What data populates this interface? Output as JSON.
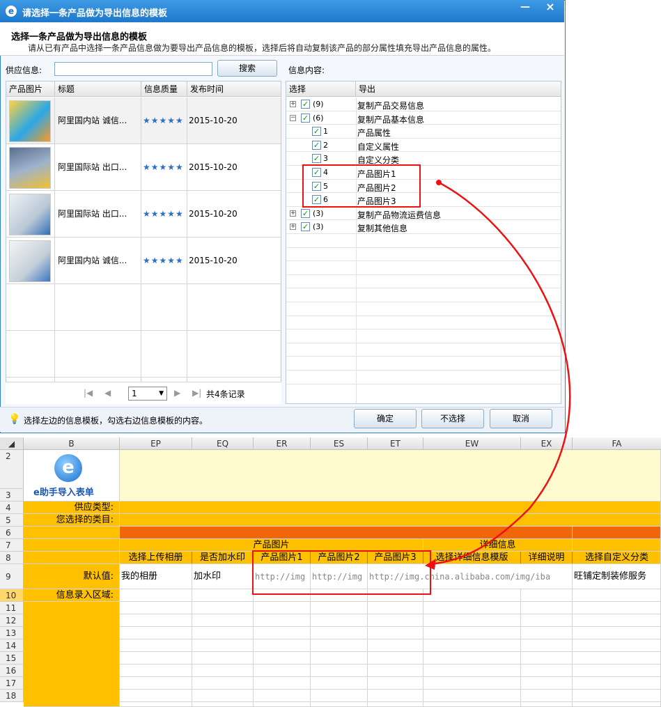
{
  "dialog": {
    "title": "请选择一条产品做为导出信息的模板",
    "min_label": "—",
    "close_label": "×",
    "heading": "选择一条产品做为导出信息的模板",
    "subheading": "请从已有产品中选择一条产品信息做为要导出产品信息的模板，选择后将自动复制该产品的部分属性填充导出产品信息的属性。",
    "supply_label": "供应信息:",
    "search_placeholder": "",
    "search_button": "搜索",
    "info_label": "信息内容:"
  },
  "left_table": {
    "columns": [
      "产品图片",
      "标题",
      "信息质量",
      "发布时间"
    ],
    "rows": [
      {
        "title": "阿里国内站 诚信...",
        "stars": "★★★★★",
        "date": "2015-10-20"
      },
      {
        "title": "阿里国际站 出口...",
        "stars": "★★★★★",
        "date": "2015-10-20"
      },
      {
        "title": "阿里国际站 出口...",
        "stars": "★★★★★",
        "date": "2015-10-20"
      },
      {
        "title": "阿里国内站 诚信...",
        "stars": "★★★★★",
        "date": "2015-10-20"
      }
    ],
    "pager": {
      "first": "|◀",
      "prev": "◀",
      "page": "1",
      "next": "▶",
      "last": "▶|",
      "total": "共4条记录"
    }
  },
  "tree": {
    "columns": [
      "选择",
      "导出"
    ],
    "rows": [
      {
        "pm": "+",
        "num": "(9)",
        "label": "复制产品交易信息"
      },
      {
        "pm": "−",
        "num": "(6)",
        "label": "复制产品基本信息"
      },
      {
        "pm": "",
        "num": "1",
        "label": "产品属性"
      },
      {
        "pm": "",
        "num": "2",
        "label": "自定义属性"
      },
      {
        "pm": "",
        "num": "3",
        "label": "自定义分类"
      },
      {
        "pm": "",
        "num": "4",
        "label": "产品图片1"
      },
      {
        "pm": "",
        "num": "5",
        "label": "产品图片2"
      },
      {
        "pm": "",
        "num": "6",
        "label": "产品图片3"
      },
      {
        "pm": "+",
        "num": "(3)",
        "label": "复制产品物流运费信息"
      },
      {
        "pm": "+",
        "num": "(3)",
        "label": "复制其他信息"
      }
    ]
  },
  "status": {
    "tip": "选择左边的信息模板，勾选右边信息模板的内容。",
    "ok": "确定",
    "none": "不选择",
    "cancel": "取消"
  },
  "sheet": {
    "columns": [
      "B",
      "EP",
      "EQ",
      "ER",
      "ES",
      "ET",
      "EW",
      "EX",
      "FA"
    ],
    "row_nums": [
      "2",
      "3",
      "4",
      "5",
      "6",
      "7",
      "8",
      "9",
      "10",
      "11",
      "12",
      "13",
      "14",
      "15",
      "16",
      "17",
      "18"
    ],
    "logo_text": "e助手导入表单",
    "supply_type": "供应类型:",
    "category": "您选择的类目:",
    "default_value": "默认值:",
    "entry_area": "信息录入区域:",
    "group_product_images": "产品图片",
    "group_detail": "详细信息",
    "headers": [
      "选择上传相册",
      "是否加水印",
      "产品图片1",
      "产品图片2",
      "产品图片3",
      "选择详细信息模版",
      "详细说明",
      "选择自定义分类"
    ],
    "defaults": [
      "我的相册",
      "加水印",
      "http://img",
      "http://img",
      "http://img.china.alibaba.com/img/iba",
      "",
      "",
      "旺铺定制装修服务"
    ]
  }
}
